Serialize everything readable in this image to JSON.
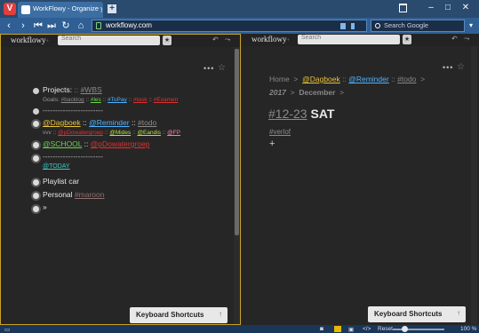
{
  "browser": {
    "tab_title": "WorkFlowy - Organize your",
    "url": "workflowy.com",
    "search_placeholder": "Search Google"
  },
  "panes": [
    {
      "logo": "workflowy",
      "search_placeholder": "Search",
      "items": {
        "projects": "Projects:",
        "projects_sep": "::",
        "projects_tag": "#WBS",
        "goals_label": "Goals:",
        "goals_tags": [
          "#backlog",
          "#les",
          "#ToPay",
          "#task",
          "#Examen"
        ],
        "divider": "------------------------",
        "dagboek": "@Dagboek",
        "reminder": "@Reminder",
        "todo": "#todo",
        "vvv_label": "vvv ::",
        "pdowatergroep": "@pDowatergroep",
        "mides": "@Mides",
        "eandis": "@Eandis",
        "fp": "@FP",
        "school": "@SCHOOL",
        "pdowatergroep2": "@pDowatergroep",
        "divider2": "------------------------",
        "today": "@TODAY",
        "playlist": "Playlist car",
        "personal": "Personal",
        "maroon": "#maroon",
        "more": "»"
      }
    },
    {
      "logo": "workflowy",
      "search_placeholder": "Search",
      "breadcrumb": {
        "home": "Home",
        "dagboek": "@Dagboek",
        "reminder": "@Reminder",
        "todo": "#todo",
        "year": "2017",
        "month": "December"
      },
      "title_tag": "#12-23",
      "title_day": "SAT",
      "note_tag": "#verlof",
      "add": "+"
    }
  ],
  "keyboard_shortcuts_label": "Keyboard Shortcuts",
  "status": {
    "reset": "Reset",
    "zoom": "100 %"
  }
}
